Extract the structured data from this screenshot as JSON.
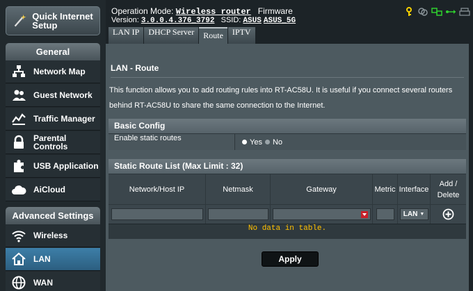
{
  "header": {
    "operation_mode_label": "Operation Mode:",
    "operation_mode_value": "Wireless router",
    "firmware_label": "Firmware",
    "version_label": "Version:",
    "version_value": "3.0.0.4.376_3792",
    "ssid_label": "SSID:",
    "ssid_1": "ASUS",
    "ssid_2": "ASUS_5G"
  },
  "sidebar": {
    "quick_setup": "Quick Internet Setup",
    "general_title": "General",
    "general_items": [
      {
        "label": "Network Map",
        "icon": "network-map-icon"
      },
      {
        "label": "Guest Network",
        "icon": "guest-network-icon"
      },
      {
        "label": "Traffic Manager",
        "icon": "traffic-manager-icon"
      },
      {
        "label": "Parental Controls",
        "icon": "lock-icon"
      },
      {
        "label": "USB Application",
        "icon": "puzzle-icon"
      },
      {
        "label": "AiCloud",
        "icon": "cloud-icon"
      }
    ],
    "advanced_title": "Advanced Settings",
    "advanced_items": [
      {
        "label": "Wireless",
        "icon": "wifi-icon"
      },
      {
        "label": "LAN",
        "icon": "home-icon"
      },
      {
        "label": "WAN",
        "icon": "globe-icon"
      }
    ],
    "active_item": "LAN"
  },
  "tabs": [
    "LAN IP",
    "DHCP Server",
    "Route",
    "IPTV"
  ],
  "active_tab": "Route",
  "main": {
    "title": "LAN - Route",
    "description": "This function allows you to add routing rules into RT-AC58U. It is useful if you connect several routers behind RT-AC58U to share the same connection to the Internet.",
    "basic_config": {
      "title": "Basic Config",
      "static_routes_label": "Enable static routes",
      "yes_label": "Yes",
      "no_label": "No",
      "selected": "No"
    },
    "route_list": {
      "title": "Static Route List (Max Limit : 32)",
      "columns": [
        "Network/Host IP",
        "Netmask",
        "Gateway",
        "Metric",
        "Interface",
        "Add / Delete"
      ],
      "interface_value": "LAN",
      "empty_text": "No data in table."
    },
    "apply_label": "Apply"
  },
  "colors": {
    "accent_blue": "#3d7fa8",
    "no_data_text": "#ffc000",
    "dropdown_red": "#c8202a"
  }
}
